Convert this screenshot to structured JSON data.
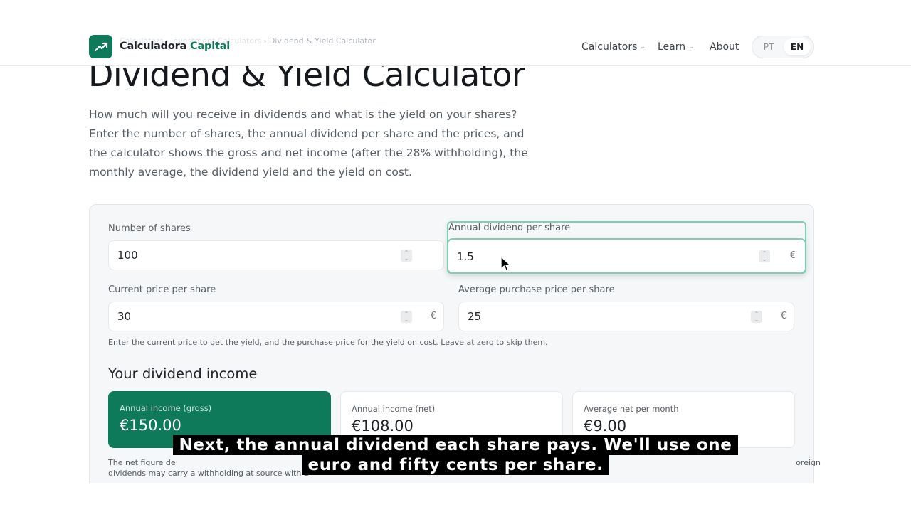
{
  "header": {
    "brand_name": "Calculadora",
    "brand_accent": "Capital",
    "breadcrumb": [
      "Calculators",
      "Investment Calculators",
      "Dividend & Yield Calculator"
    ],
    "breadcrumb_sep": "›",
    "nav": {
      "calculators": "Calculators",
      "learn": "Learn",
      "about": "About"
    },
    "lang": {
      "pt": "PT",
      "en": "EN",
      "selected": "EN"
    },
    "logo_icon": "trending-up-icon",
    "accent_color": "#0f7a5a"
  },
  "page": {
    "title": "Dividend & Yield Calculator",
    "intro": "How much will you receive in dividends and what is the yield on your shares? Enter the number of shares, the annual dividend per share and the prices, and the calculator shows the gross and net income (after the 28% withholding), the monthly average, the dividend yield and the yield on cost."
  },
  "form": {
    "shares": {
      "label": "Number of shares",
      "value": "100"
    },
    "dividend": {
      "label": "Annual dividend per share",
      "value": "1.5",
      "unit": "€"
    },
    "current_price": {
      "label": "Current price per share",
      "value": "30",
      "unit": "€"
    },
    "purchase_price": {
      "label": "Average purchase price per share",
      "value": "25",
      "unit": "€"
    },
    "hint": "Enter the current price to get the yield, and the purchase price for the yield on cost. Leave at zero to skip them."
  },
  "results": {
    "title": "Your dividend income",
    "gross": {
      "label": "Annual income (gross)",
      "value": "€150.00"
    },
    "net": {
      "label": "Annual income (net)",
      "value": "€108.00"
    },
    "monthly": {
      "label": "Average net per month",
      "value": "€9.00"
    },
    "note_start": "The net figure de",
    "note_end": "oreign",
    "note_line2": "dividends may carry a withholding at source with a"
  },
  "subtitle": {
    "line1": "Next, the annual dividend each share pays. We'll use one",
    "line2": "euro and fifty cents per share."
  }
}
